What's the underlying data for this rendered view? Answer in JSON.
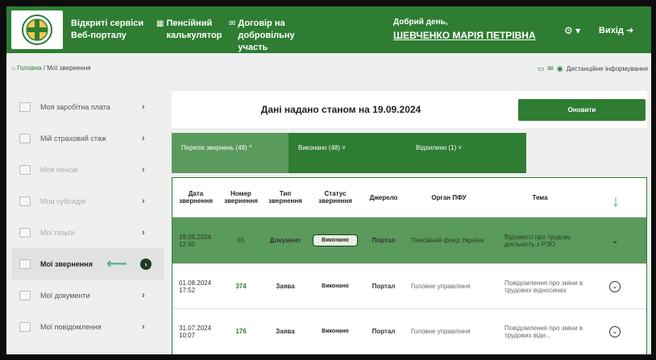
{
  "header": {
    "nav1": {
      "icon": "none",
      "label": "Відкриті сервіси Веб-порталу"
    },
    "nav2": {
      "icon": "calculator-icon",
      "label": "Пенсійний калькулятор"
    },
    "nav3": {
      "icon": "envelope-icon",
      "label": "Договір на добровільну участь"
    },
    "greeting": "Добрий день,",
    "user_name": "ШЕВЧЕНКО МАРІЯ ПЕТРІВНА",
    "settings_label": "▾",
    "logout_label": "Вихід"
  },
  "breadcrumb": {
    "home": "Головна",
    "separator": " / ",
    "current": "Мої звернення"
  },
  "remote_info": "Дистанційне інформування",
  "sidebar": {
    "items": [
      {
        "label": "Моя заробітна плата",
        "dim": false,
        "active": false
      },
      {
        "label": "Мій страховий стаж",
        "dim": false,
        "active": false
      },
      {
        "label": "Моя пенсія",
        "dim": true,
        "active": false
      },
      {
        "label": "Мои субсидія",
        "dim": true,
        "active": false
      },
      {
        "label": "Мої пільги",
        "dim": true,
        "active": false
      },
      {
        "label": "Мої звернення",
        "dim": false,
        "active": true
      },
      {
        "label": "Мої документи",
        "dim": false,
        "active": false
      },
      {
        "label": "Мої повідомлення",
        "dim": false,
        "active": false
      }
    ]
  },
  "main": {
    "date_text": "Дані надано станом на 19.09.2024",
    "refresh_label": "Оновити",
    "tabs": [
      {
        "label": "Перелік звернень (49) ^"
      },
      {
        "label": "Виконано (48) ˅"
      },
      {
        "label": "Відхилено (1) ˅"
      }
    ],
    "table": {
      "headers": [
        "Дата звернення",
        "Номер звернення",
        "Тип звернення",
        "Статус звернення",
        "Джерело",
        "Орган ПФУ",
        "Тема"
      ],
      "rows": [
        {
          "date": "19.09.2024",
          "time": "12:40",
          "number": "65",
          "type": "Документ",
          "status": "Виконано",
          "source": "Портал",
          "organ": "Пенсійний фонд України",
          "topic": "Відомості про трудову діяльність з РЭО"
        },
        {
          "date": "01.08.2024",
          "time": "17:52",
          "number": "374",
          "type": "Заява",
          "status": "Виконано",
          "source": "Портал",
          "organ": "Головне управління",
          "topic": "Повідомлення про зміни в трудових відносинах"
        },
        {
          "date": "31.07.2024",
          "time": "10:07",
          "number": "176",
          "type": "Заява",
          "status": "Виконано",
          "source": "Портал",
          "organ": "Головне управління",
          "topic": "Повідомлення про зміни в трудових відн..."
        }
      ]
    }
  },
  "colors": {
    "brand": "#2e7d32",
    "tab_active": "#5a9a5d",
    "accent_arrow": "#4caf8a"
  }
}
